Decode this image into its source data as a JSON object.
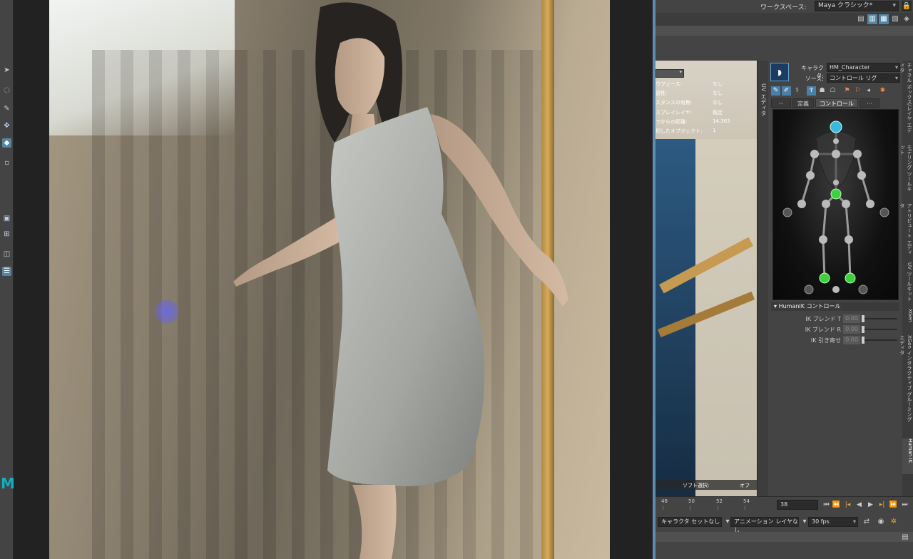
{
  "topbar": {
    "workspace_label": "ワークスペース:",
    "workspace_value": "Maya クラシック*"
  },
  "hud": {
    "rows": [
      {
        "key": "ウフェース:",
        "value": "なし"
      },
      {
        "key": "習性:",
        "value": "なし"
      },
      {
        "key": "スタンスの有無:",
        "value": "なし"
      },
      {
        "key": "スプレイレイヤ:",
        "value": "既定"
      },
      {
        "key": "ラからの距離:",
        "value": "14.363"
      },
      {
        "key": "択したオブジェクト:",
        "value": "1"
      }
    ],
    "footer_key": "ソフト選択:",
    "footer_value": "オフ"
  },
  "uv_tab": "UV エディタ",
  "humanik": {
    "character_label": "キャラクタ:",
    "character_value": "HM_Character",
    "source_label": "ソース:",
    "source_value": "コントロール リグ",
    "tabs": [
      "···",
      "定義",
      "コントロール",
      "···"
    ],
    "section_title": "HumanIK コントロール",
    "params": [
      {
        "label": "IK ブレンド T",
        "value": "0.00"
      },
      {
        "label": "IK ブレンド R",
        "value": "0.00"
      },
      {
        "label": "IK 引き寄せ",
        "value": "0.00"
      }
    ]
  },
  "right_tabs": [
    "チャネル ボックス/レイヤ エディタ",
    "モデリング ツールキット",
    "アトリビュート エディタ",
    "UV ツールキット",
    "XGen",
    "XGen インタラクティブ グルーミング エディタ",
    "Human IK"
  ],
  "timeline": {
    "ticks": [
      "48",
      "50",
      "52",
      "54"
    ],
    "current_frame": "38"
  },
  "bottom": {
    "character_set": "キャラクタ セットなし",
    "anim_layer": "アニメーション レイヤなし",
    "fps": "30 fps"
  },
  "icons": {
    "lock": "lock-icon",
    "play": "play-icon",
    "rig": "humanik-rig-icon"
  },
  "colors": {
    "accent": "#5285a6",
    "rig_active": "#3fd040",
    "rig_head": "#3ab8e0"
  }
}
